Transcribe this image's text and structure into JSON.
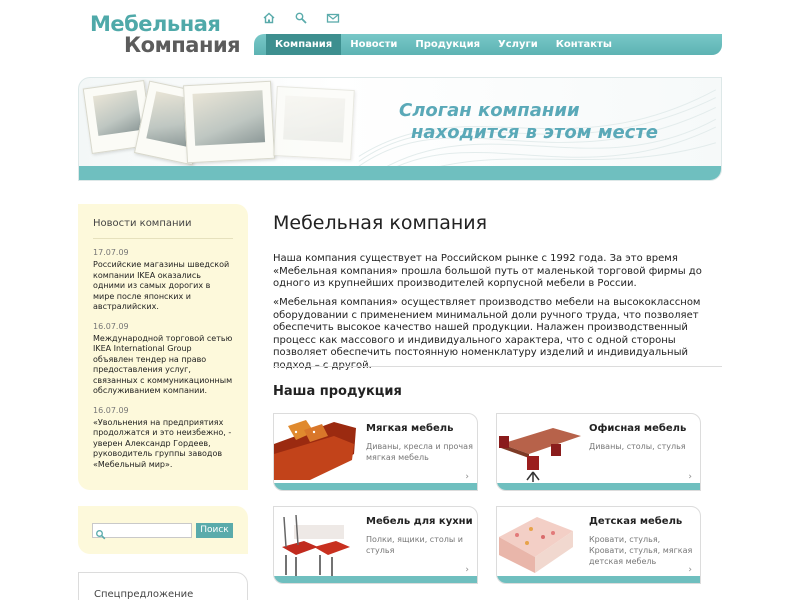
{
  "logo": {
    "line1": "Мебельная",
    "line2": "Компания"
  },
  "top_icons": [
    "home-icon",
    "search-icon",
    "mail-icon"
  ],
  "nav": {
    "items": [
      "Компания",
      "Новости",
      "Продукция",
      "Услуги",
      "Контакты"
    ],
    "active": "Компания"
  },
  "banner": {
    "slogan_line1": "Слоган компании",
    "slogan_line2": "находится в этом месте"
  },
  "sidebar": {
    "news_title": "Новости компании",
    "news": [
      {
        "date": "17.07.09",
        "text": "Российские магазины шведской компании IKEA оказались одними из самых дорогих в мире после японских и австралийских."
      },
      {
        "date": "16.07.09",
        "text": "Международной торговой сетью IKEA International Group объявлен тендер на право предоставления услуг, связанных с коммуникационным обслуживанием компании."
      },
      {
        "date": "16.07.09",
        "text": "«Увольнения на предприятиях продолжатся и это неизбежно, - уверен Александр Гордеев, руководитель группы заводов «Мебельный мир»."
      }
    ],
    "search": {
      "placeholder": "",
      "button": "Поиск"
    },
    "special_title": "Спецпредложение"
  },
  "main": {
    "title": "Мебельная компания",
    "paragraph1": "Наша компания существует на Российском рынке с 1992 года. За это время «Мебельная компания» прошла большой путь от маленькой торговой фирмы до одного из крупнейших производителей корпусной мебели в России.",
    "paragraph2": "«Мебельная компания» осуществляет производство мебели на высококлассном оборудовании с применением минимальной доли ручного труда, что позволяет обеспечить высокое качество нашей продукции. Налажен производственный процесс как массового и индивидуального характера, что с одной стороны позволяет обеспечить постоянную номенклатуру изделий и индивидуальный подход – с другой.",
    "products_title": "Наша продукция",
    "products": [
      {
        "name": "Мягкая мебель",
        "desc": "Диваны, кресла и прочая мягкая мебель",
        "arrow": "›"
      },
      {
        "name": "Офисная мебель",
        "desc": "Диваны, столы, стулья",
        "arrow": "›"
      },
      {
        "name": "Мебель для кухни",
        "desc": "Полки, ящики, столы и стулья",
        "arrow": "›"
      },
      {
        "name": "Детская мебель",
        "desc": "Кровати, стулья, Кровати, стулья, мягкая детская мебель",
        "arrow": "›"
      }
    ]
  },
  "colors": {
    "accent": "#5db3b3",
    "nav_active": "#3d8f8f",
    "sidebar_bg": "#fdf9db",
    "slogan": "#5aa9b8"
  }
}
